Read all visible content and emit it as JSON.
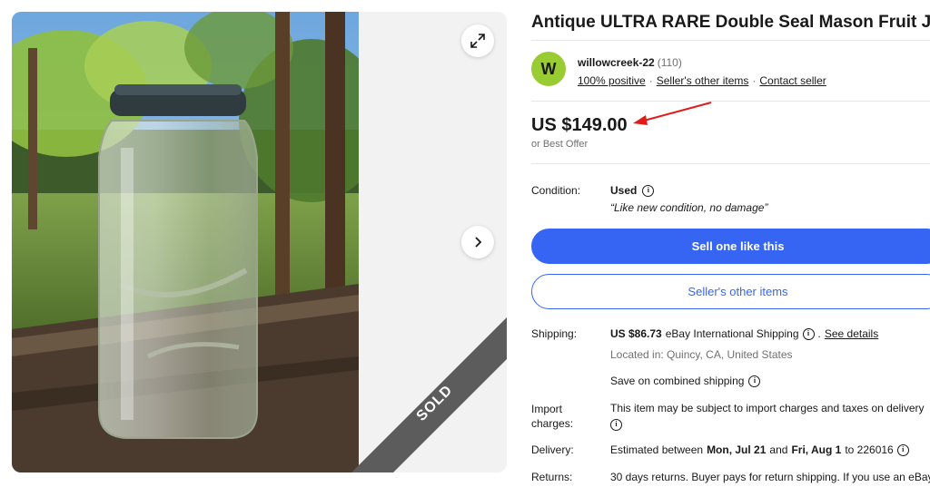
{
  "gallery": {
    "sold_label": "SOLD",
    "icons": {
      "expand": "expand-icon",
      "next": "chevron-right-icon"
    }
  },
  "listing": {
    "title": "Antique ULTRA RARE Double Seal Mason Fruit Jar",
    "seller": {
      "avatar_letter": "W",
      "name": "willowcreek-22",
      "feedback_count": "(110)",
      "positive": "100% positive",
      "other_items_link": "Seller's other items",
      "contact_link": "Contact seller"
    },
    "price": "US $149.00",
    "best_offer": "or Best Offer",
    "condition": {
      "label": "Condition:",
      "value": "Used",
      "quote": "“Like new condition, no damage”"
    },
    "buttons": {
      "sell_one": "Sell one like this",
      "seller_items": "Seller's other items"
    },
    "shipping": {
      "label": "Shipping:",
      "cost": "US $86.73",
      "method": "eBay International Shipping",
      "see_details": "See details",
      "location": "Located in: Quincy, CA, United States",
      "combined": "Save on combined shipping"
    },
    "import": {
      "label_line1": "Import",
      "label_line2": "charges:",
      "text": "This item may be subject to import charges and taxes on delivery"
    },
    "delivery": {
      "label": "Delivery:",
      "prefix": "Estimated between",
      "start": "Mon, Jul 21",
      "and": "and",
      "end": "Fri, Aug 1",
      "suffix": "to 226016"
    },
    "returns": {
      "label": "Returns:",
      "text": "30 days returns. Buyer pays for return shipping. If you use an eBay"
    }
  },
  "colors": {
    "primary_blue": "#3665f3",
    "avatar_green": "#99cc33",
    "sold_ribbon": "#5c5c5c",
    "annotation_arrow": "#e01b1b"
  }
}
